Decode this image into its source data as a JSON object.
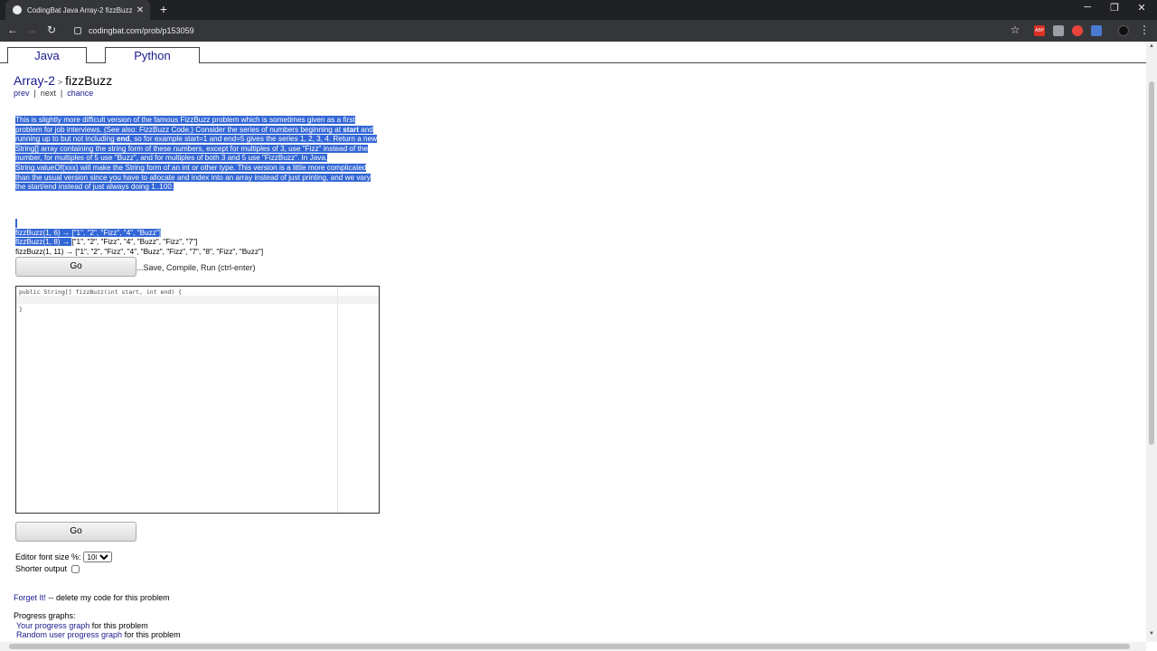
{
  "browser": {
    "tab_title": "CodingBat Java Array-2 fizzBuzz",
    "tab_close": "✕",
    "new_tab": "+",
    "url": "codingbat.com/prob/p153059",
    "minimize": "─",
    "restore": "❐",
    "close": "✕",
    "back": "←",
    "forward": "→",
    "reload": "↻",
    "star": "☆",
    "menu": "⋮",
    "ext_abp": "ABP"
  },
  "lang_tabs": {
    "java": "Java",
    "python": "Python"
  },
  "breadcrumb": {
    "section": "Array-2",
    "sep": ">",
    "problem": "fizzBuzz"
  },
  "subnav": {
    "prev": "prev",
    "next": "next",
    "chance": "chance",
    "bar": "|"
  },
  "description": {
    "p1": "This is slightly more difficult version of the famous FizzBuzz problem which is sometimes given as a first problem for job interviews. (See also: FizzBuzz Code.) Consider the series of numbers beginning at ",
    "start": "start",
    "p2": " and running up to but not including ",
    "end": "end",
    "p3": ", so for example start=1 and end=5 gives the series 1, 2, 3, 4. Return a new String[] array containing the string form of these numbers, except for multiples of 3, use \"Fizz\" instead of the number, for multiples of 5 use \"Buzz\", and for multiples of both 3 and 5 use \"FizzBuzz\". In Java, String.valueOf(xxx) will make the String form of an int or other type. This version is a little more complicated than the usual version since you have to allocate and index into an array instead of just printing, and we vary the start/end instead of just always doing 1..100."
  },
  "examples": [
    "fizzBuzz(1, 6) → [\"1\", \"2\", \"Fizz\", \"4\", \"Buzz\"]",
    "fizzBuzz(1, 8) → ",
    "[\"1\", \"2\", \"Fizz\", \"4\", \"Buzz\", \"Fizz\", \"7\"]",
    "fizzBuzz(1, 11) → [\"1\", \"2\", \"Fizz\", \"4\", \"Buzz\", \"Fizz\", \"7\", \"8\", \"Fizz\", \"Buzz\"]"
  ],
  "go_label": "Go",
  "go_hint": "...Save, Compile, Run (ctrl-enter)",
  "editor": {
    "code": "public String[] fizzBuzz(int start, int end) {\n  \n}"
  },
  "font_size": {
    "label": "Editor font size %:",
    "value": "100"
  },
  "shorter_output": {
    "label": "Shorter output",
    "checked": false
  },
  "forget": {
    "link": "Forget It!",
    "text": " -- delete my code for this problem"
  },
  "progress": {
    "heading": "Progress graphs:",
    "your_link": "Your progress graph",
    "your_text": " for this problem",
    "random_link": "Random user progress graph",
    "random_text": " for this problem"
  },
  "colors": {
    "selection": "#3367d6",
    "link": "#1a1a8e",
    "chrome_dark": "#202124"
  }
}
